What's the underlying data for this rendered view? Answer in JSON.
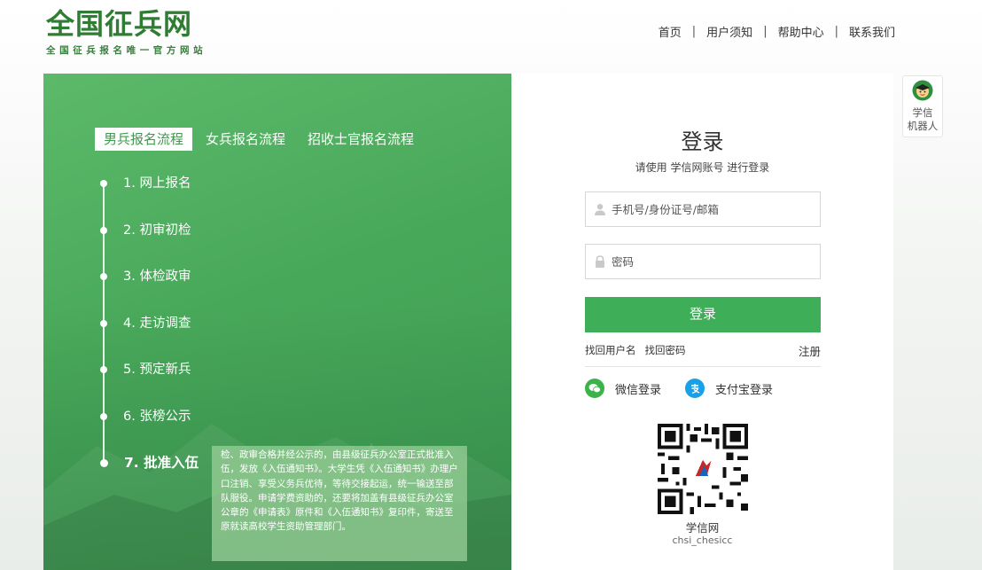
{
  "header": {
    "logo_title": "全国征兵网",
    "logo_subtitle": "全国征兵报名唯一官方网站",
    "nav": [
      "首页",
      "用户须知",
      "帮助中心",
      "联系我们"
    ],
    "nav_separator": "|"
  },
  "process": {
    "tabs": [
      "男兵报名流程",
      "女兵报名流程",
      "招收士官报名流程"
    ],
    "active_tab": 0,
    "steps": [
      "1. 网上报名",
      "2. 初审初检",
      "3. 体检政审",
      "4. 走访调查",
      "5. 预定新兵",
      "6. 张榜公示",
      "7. 批准入伍"
    ],
    "active_step": 6,
    "tip_text": "检、政审合格并经公示的，由县级征兵办公室正式批准入伍，发放《入伍通知书》。大学生凭《入伍通知书》办理户口注销、享受义务兵优待，等待交接起运，统一输送至部队服役。申请学费资助的，还要将加盖有县级征兵办公室公章的《申请表》原件和《入伍通知书》复印件，寄送至原就读高校学生资助管理部门。"
  },
  "login": {
    "title": "登录",
    "subtitle": "请使用 学信网账号 进行登录",
    "username_placeholder": "手机号/身份证号/邮箱",
    "password_placeholder": "密码",
    "submit_label": "登录",
    "find_username": "找回用户名",
    "find_password": "找回密码",
    "register": "注册",
    "wechat_login": "微信登录",
    "alipay_login": "支付宝登录",
    "qr_name": "学信网",
    "qr_id": "chsi_chesicc"
  },
  "robot": {
    "label_line1": "学信",
    "label_line2": "机器人"
  },
  "colors": {
    "brand_green": "#3fae58",
    "logo_green": "#2e7d32",
    "wechat": "#3cb34a",
    "alipay": "#1aa0e6"
  },
  "icons": {
    "user": "user-icon",
    "lock": "lock-icon",
    "wechat": "wechat-icon",
    "alipay": "alipay-icon",
    "robot": "robot-icon"
  }
}
